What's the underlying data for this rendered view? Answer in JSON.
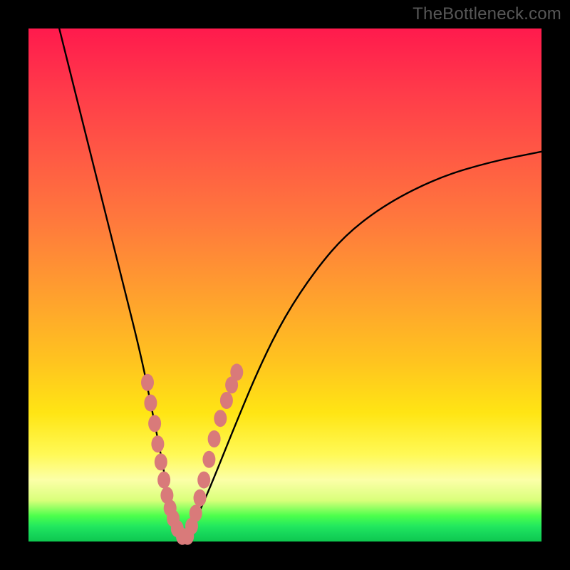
{
  "watermark": "TheBottleneck.com",
  "chart_data": {
    "type": "line",
    "title": "",
    "xlabel": "",
    "ylabel": "",
    "xlim": [
      0,
      100
    ],
    "ylim": [
      0,
      100
    ],
    "grid": false,
    "legend": false,
    "series": [
      {
        "name": "bottleneck-curve",
        "x": [
          6,
          10,
          14,
          18,
          22,
          24,
          26,
          27,
          28,
          29,
          30,
          31,
          33,
          36,
          40,
          45,
          50,
          56,
          62,
          70,
          80,
          90,
          100
        ],
        "y": [
          100,
          84,
          68,
          52,
          36,
          26,
          16,
          10,
          5,
          2,
          1,
          2,
          5,
          12,
          22,
          34,
          44,
          53,
          60,
          66,
          71,
          74,
          76
        ]
      }
    ],
    "left_markers": {
      "name": "left-branch-dots",
      "x": [
        23.2,
        23.8,
        24.6,
        25.2,
        25.8,
        26.4,
        27.0,
        27.6,
        28.2,
        29.0,
        30.0
      ],
      "y": [
        31.0,
        27.0,
        23.0,
        19.0,
        15.5,
        12.0,
        9.0,
        6.5,
        4.5,
        2.5,
        1.0
      ]
    },
    "right_markers": {
      "name": "right-branch-dots",
      "x": [
        31.0,
        31.8,
        32.6,
        33.4,
        34.2,
        35.2,
        36.2,
        37.4,
        38.6,
        39.6,
        40.6
      ],
      "y": [
        1.0,
        3.0,
        5.5,
        8.5,
        12.0,
        16.0,
        20.0,
        24.0,
        27.5,
        30.5,
        33.0
      ]
    }
  }
}
